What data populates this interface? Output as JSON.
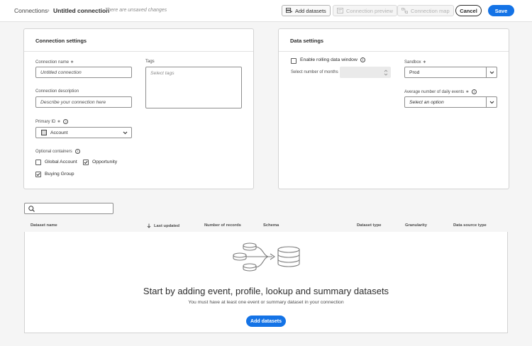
{
  "header": {
    "breadcrumb_root": "Connections",
    "title": "Untitled connection",
    "unsaved": "There are unsaved changes",
    "add_datasets": "Add datasets",
    "connection_preview": "Connection preview",
    "connection_map": "Connection map",
    "cancel": "Cancel",
    "save": "Save"
  },
  "connection_settings": {
    "title": "Connection settings",
    "name_label": "Connection name",
    "name_value": "Untitled connection",
    "tags_label": "Tags",
    "tags_placeholder": "Select tags",
    "desc_label": "Connection description",
    "desc_placeholder": "Describe your connection here",
    "primary_id_label": "Primary ID",
    "primary_id_value": "Account",
    "optional_label": "Optional containers",
    "containers": [
      {
        "label": "Global Account",
        "checked": false
      },
      {
        "label": "Opportunity",
        "checked": true
      },
      {
        "label": "Buying Group",
        "checked": true
      }
    ]
  },
  "data_settings": {
    "title": "Data settings",
    "rolling_label": "Enable rolling data window",
    "rolling_checked": false,
    "months_label": "Select number of months",
    "sandbox_label": "Sandbox",
    "sandbox_value": "Prod",
    "daily_label": "Average number of daily events",
    "daily_placeholder": "Select an option"
  },
  "table": {
    "search_placeholder": "",
    "columns": [
      "Dataset name",
      "Last updated",
      "Number of records",
      "Schema",
      "Dataset type",
      "Granularity",
      "Data source type"
    ],
    "empty_title": "Start by adding event, profile, lookup and summary datasets",
    "empty_subtitle": "You must have at least one event or summary dataset in your connection",
    "add_button": "Add datasets"
  },
  "colors": {
    "accent": "#1473e6",
    "background": "#f5f5f5"
  }
}
